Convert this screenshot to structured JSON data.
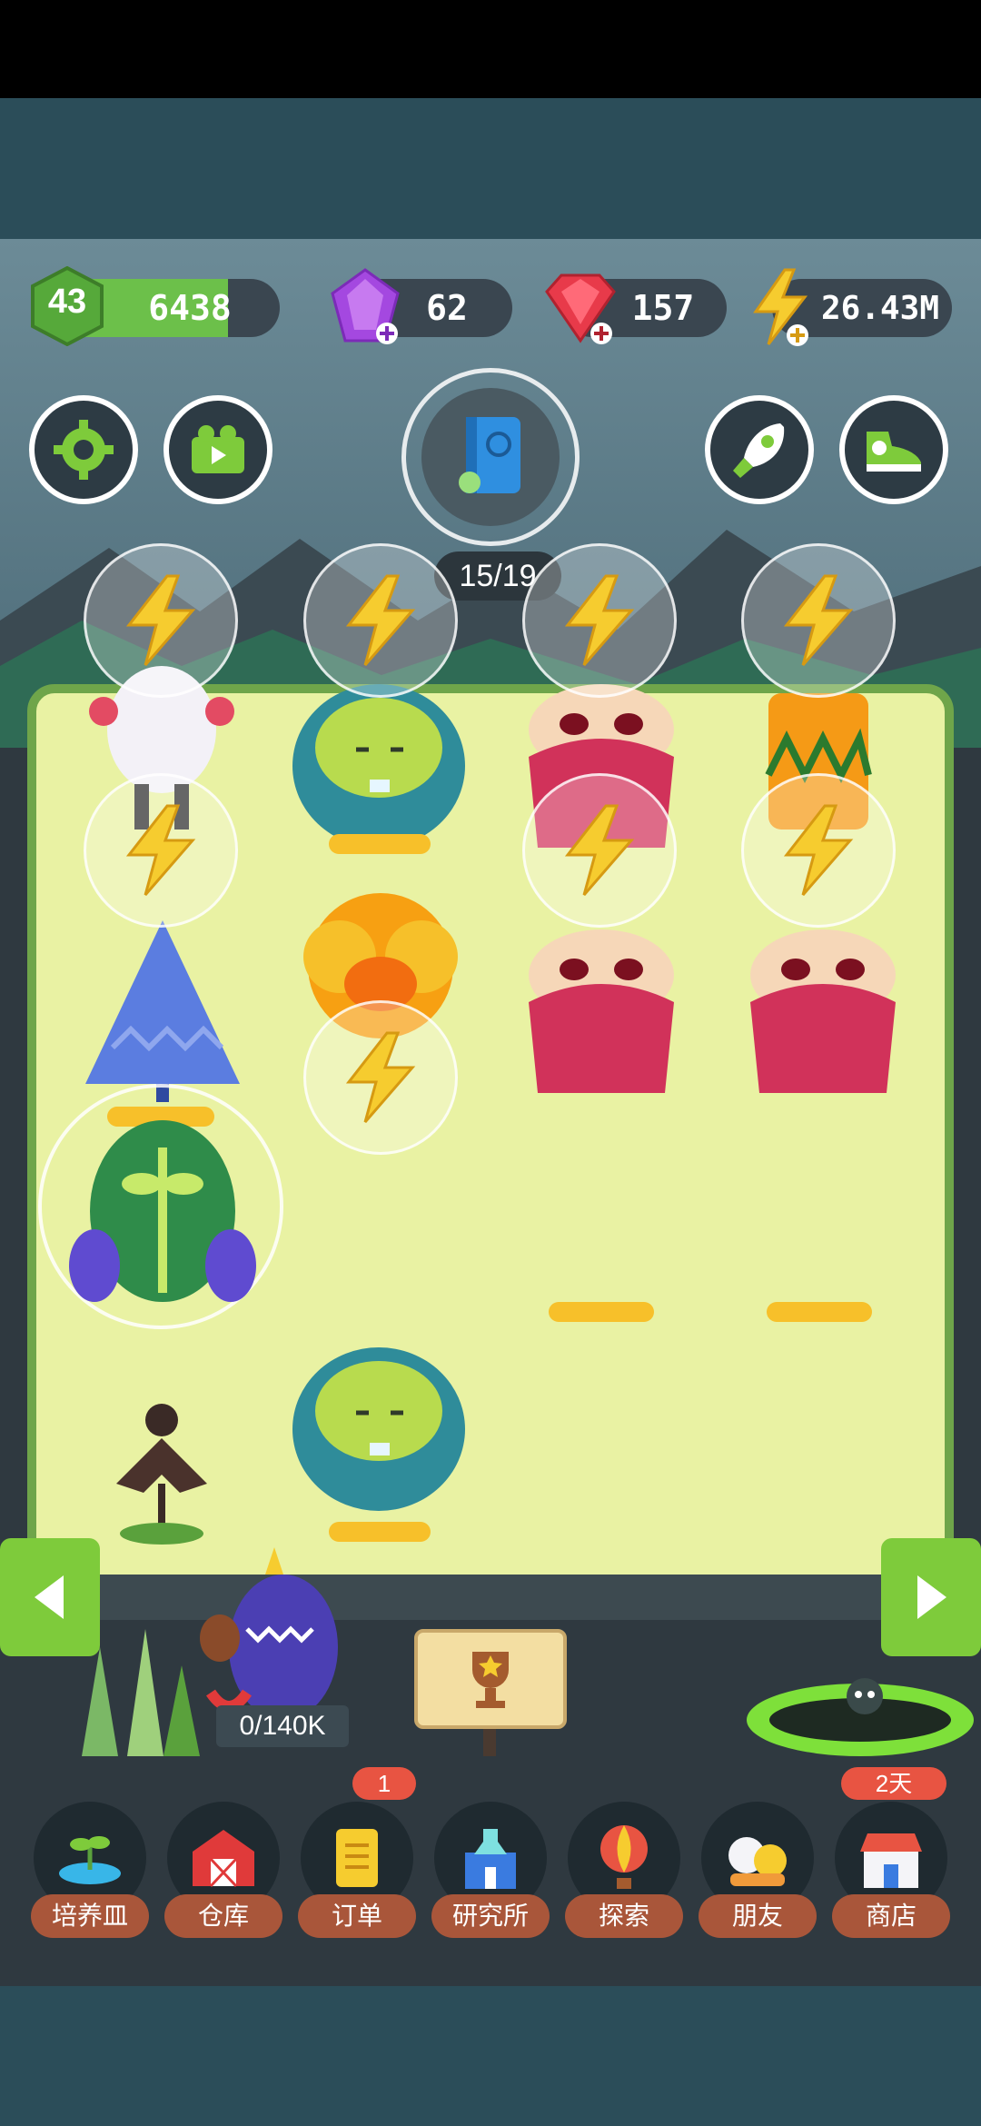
{
  "hud": {
    "level": "43",
    "level_points": "6438",
    "purple_gems": "62",
    "red_gems": "157",
    "energy": "26.43M"
  },
  "progress": {
    "label": "15/19"
  },
  "storage": {
    "capacity": "0/140K"
  },
  "nav": {
    "items": [
      {
        "label": "培养皿"
      },
      {
        "label": "仓库"
      },
      {
        "label": "订单",
        "badge": "1"
      },
      {
        "label": "研究所"
      },
      {
        "label": "探索"
      },
      {
        "label": "朋友"
      },
      {
        "label": "商店",
        "badge": "2天"
      }
    ]
  },
  "colors": {
    "accent_green": "#7ecb3b",
    "energy_yellow": "#f6cc2f",
    "nav_label_bg": "#a9563a",
    "badge_red": "#e85442"
  }
}
